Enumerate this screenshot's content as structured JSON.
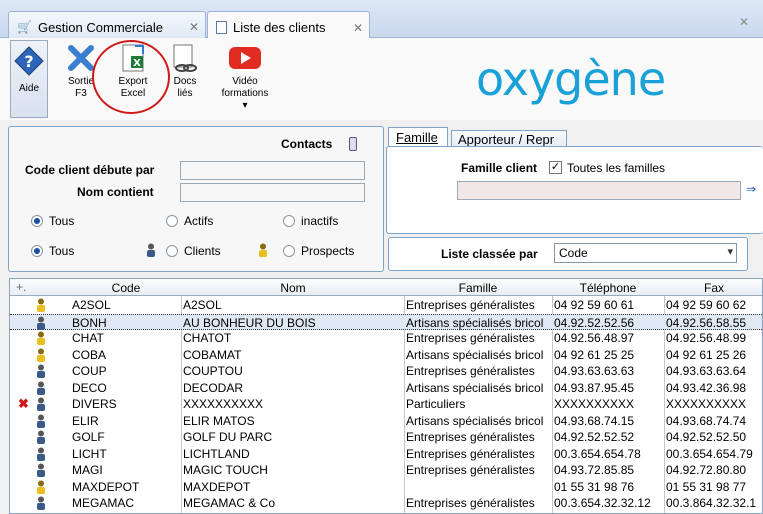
{
  "tabs": [
    {
      "label": "Gestion Commerciale",
      "close": "✕"
    },
    {
      "label": "Liste des clients",
      "close": "✕"
    }
  ],
  "window_close": "✕",
  "toolbar": {
    "aide": "Aide",
    "sortie": "Sortie\nF3",
    "export": "Export\nExcel",
    "docs": "Docs\nliés",
    "video": "Vidéo\nformations",
    "video_arrow": "▾"
  },
  "logo": "oxygène",
  "contacts_panel": {
    "title": "Contacts",
    "code_label": "Code client débute par",
    "code_value": "",
    "nom_label": "Nom contient",
    "nom_value": "",
    "row1": [
      "Tous",
      "Actifs",
      "inactifs"
    ],
    "row2": [
      "Tous",
      "Clients",
      "Prospects"
    ]
  },
  "famille_panel": {
    "tabs": [
      "Famille",
      "Apporteur / Repr"
    ],
    "famille_label": "Famille client",
    "toutes_label": "Toutes les familles",
    "arrow": "⇒"
  },
  "liste_panel": {
    "label": "Liste classée par",
    "value": "Code"
  },
  "grid": {
    "corner": "+.",
    "headers": [
      "Code",
      "Nom",
      "Famille",
      "Téléphone",
      "Fax"
    ],
    "rows": [
      {
        "code": "A2SOL",
        "nom": "A2SOL",
        "famille": "Entreprises généralistes",
        "tel": "04 92 59 60 61",
        "fax": "04 92 59 60 62",
        "icon": "yellow",
        "mark": ""
      },
      {
        "code": "BONH",
        "nom": "AU BONHEUR DU BOIS",
        "famille": "Artisans spécialisés bricol",
        "tel": "04.92.52.52.56",
        "fax": "04.92.56.58.55",
        "icon": "blue",
        "mark": "",
        "sel": true
      },
      {
        "code": "CHAT",
        "nom": "CHATOT",
        "famille": "Entreprises généralistes",
        "tel": "04.92.56.48.97",
        "fax": "04.92.56.48.99",
        "icon": "yellow",
        "mark": ""
      },
      {
        "code": "COBA",
        "nom": "COBAMAT",
        "famille": "Artisans spécialisés bricol",
        "tel": "04 92 61 25 25",
        "fax": "04 92 61 25 26",
        "icon": "yellow",
        "mark": ""
      },
      {
        "code": "COUP",
        "nom": "COUPTOU",
        "famille": "Entreprises généralistes",
        "tel": "04.93.63.63.63",
        "fax": "04.93.63.63.64",
        "icon": "blue",
        "mark": ""
      },
      {
        "code": "DECO",
        "nom": "DECODAR",
        "famille": "Artisans spécialisés bricol",
        "tel": "04.93.87.95.45",
        "fax": "04.93.42.36.98",
        "icon": "blue",
        "mark": ""
      },
      {
        "code": "DIVERS",
        "nom": "XXXXXXXXXX",
        "famille": "Particuliers",
        "tel": "XXXXXXXXXX",
        "fax": "XXXXXXXXXX",
        "icon": "blue",
        "mark": "x"
      },
      {
        "code": "ELIR",
        "nom": "ELIR MATOS",
        "famille": "Artisans spécialisés bricol",
        "tel": "04.93.68.74.15",
        "fax": "04.93.68.74.74",
        "icon": "blue",
        "mark": ""
      },
      {
        "code": "GOLF",
        "nom": "GOLF DU PARC",
        "famille": "Entreprises généralistes",
        "tel": "04.92.52.52.52",
        "fax": "04.92.52.52.50",
        "icon": "blue",
        "mark": ""
      },
      {
        "code": "LICHT",
        "nom": "LICHTLAND",
        "famille": "Entreprises généralistes",
        "tel": "00.3.654.654.78",
        "fax": "00.3.654.654.79",
        "icon": "blue",
        "mark": ""
      },
      {
        "code": "MAGI",
        "nom": "MAGIC TOUCH",
        "famille": "Entreprises généralistes",
        "tel": "04.93.72.85.85",
        "fax": "04.92.72.80.80",
        "icon": "blue",
        "mark": ""
      },
      {
        "code": "MAXDEPOT",
        "nom": "MAXDEPOT",
        "famille": "",
        "tel": "01 55 31 98 76",
        "fax": "01 55 31 98 77",
        "icon": "yellow",
        "mark": ""
      },
      {
        "code": "MEGAMAC",
        "nom": "MEGAMAC & Co",
        "famille": "Entreprises généralistes",
        "tel": "00.3.654.32.32.12",
        "fax": "00.3.864.32.32.1",
        "icon": "blue",
        "mark": ""
      }
    ]
  },
  "colors": {
    "accent": "#1aa1d8",
    "highlight_circle": "#d01818",
    "selected_row": "#dfe8f3"
  }
}
